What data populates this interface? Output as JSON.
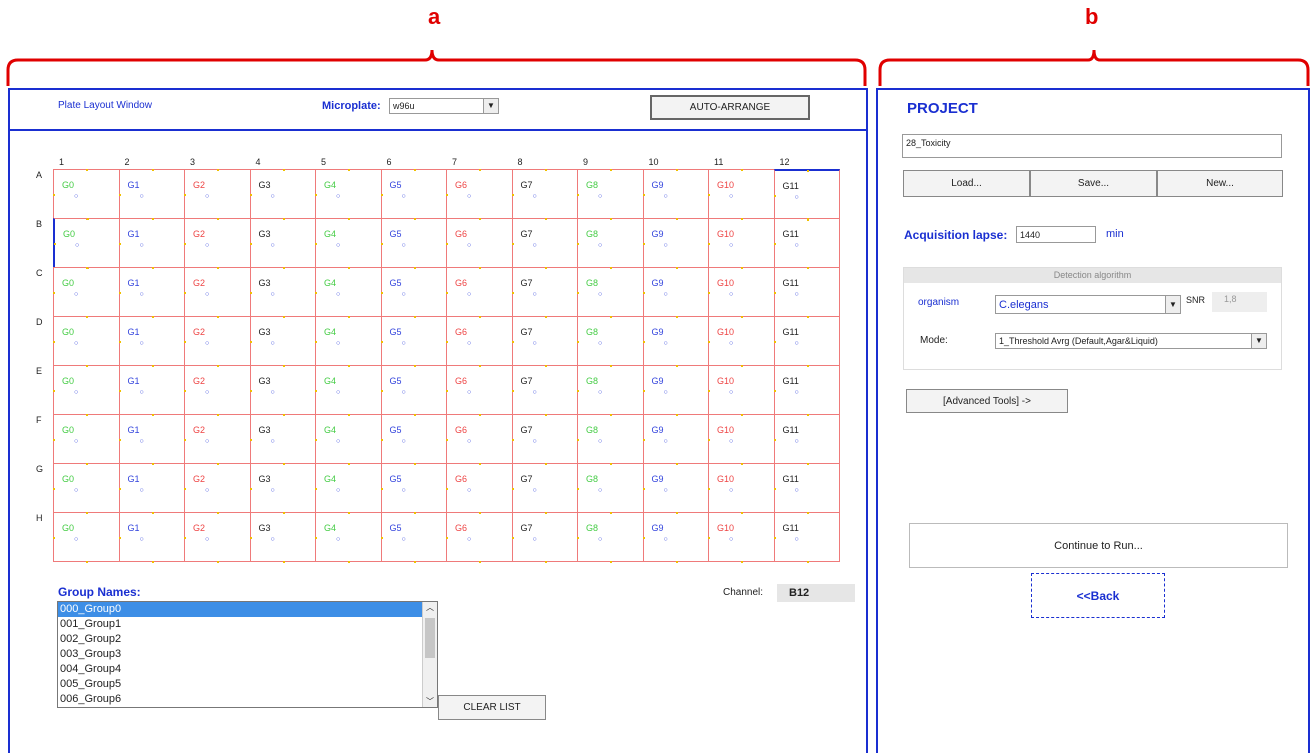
{
  "annotations": {
    "a": "a",
    "b": "b"
  },
  "left_panel": {
    "title": "Plate Layout Window",
    "microplate_label": "Microplate:",
    "microplate_value": "w96u",
    "auto_arrange": "AUTO-ARRANGE",
    "columns": [
      "1",
      "2",
      "3",
      "4",
      "5",
      "6",
      "7",
      "8",
      "9",
      "10",
      "11",
      "12"
    ],
    "rows": [
      "A",
      "B",
      "C",
      "D",
      "E",
      "F",
      "G",
      "H"
    ],
    "group_labels": [
      "G0",
      "G1",
      "G2",
      "G3",
      "G4",
      "G5",
      "G6",
      "G7",
      "G8",
      "G9",
      "G10",
      "G11"
    ],
    "group_colors": [
      "#44cc44",
      "#3344dd",
      "#ee4444",
      "#222222",
      "#44cc44",
      "#3344dd",
      "#ee4444",
      "#222222",
      "#44cc44",
      "#3344dd",
      "#ee4444",
      "#222222"
    ],
    "group_names_label": "Group Names:",
    "group_names": [
      "000_Group0",
      "001_Group1",
      "002_Group2",
      "003_Group3",
      "004_Group4",
      "005_Group5",
      "006_Group6"
    ],
    "selected_group_index": 0,
    "channel_label": "Channel:",
    "channel_value": "B12",
    "clear_list": "CLEAR LIST"
  },
  "right_panel": {
    "title": "PROJECT",
    "project_name": "28_Toxicity",
    "load": "Load...",
    "save": "Save...",
    "new": "New...",
    "acq_label": "Acquisition lapse:",
    "acq_value": "1440",
    "acq_unit": "min",
    "detection_title": "Detection algorithm",
    "organism_label": "organism",
    "organism_value": "C.elegans",
    "snr_label": "SNR",
    "snr_value": "1,8",
    "mode_label": "Mode:",
    "mode_value": "1_Threshold Avrg (Default,Agar&Liquid)",
    "advanced_tools": "[Advanced Tools] ->",
    "continue": "Continue to Run...",
    "back": "<<Back"
  },
  "colors": {
    "accent_blue": "#1a2fd1",
    "annotation_red": "#e00000",
    "well_border": "#ef7a7a",
    "selection": "#3d8ee6"
  }
}
